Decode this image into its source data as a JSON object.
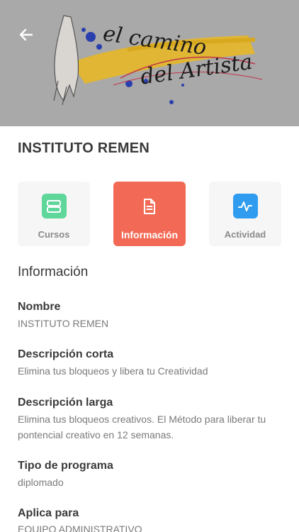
{
  "header": {
    "back_icon": "arrow-left-icon",
    "banner_line1": "el camino",
    "banner_line2": "del Artista"
  },
  "institution": {
    "title": "INSTITUTO REMEN"
  },
  "tabs": [
    {
      "label": "Cursos",
      "icon": "stacked-rows-icon",
      "icon_color": "#5fd69a"
    },
    {
      "label": "Información",
      "icon": "document-icon",
      "icon_color": "#f26a55",
      "active": true
    },
    {
      "label": "Actividad",
      "icon": "activity-pulse-icon",
      "icon_color": "#2f9cf0"
    }
  ],
  "info": {
    "section_title": "Información",
    "fields": [
      {
        "label": "Nombre",
        "value": "INSTITUTO REMEN"
      },
      {
        "label": "Descripción corta",
        "value": "Elimina tus bloqueos y libera tu Creatividad"
      },
      {
        "label": "Descripción larga",
        "value": "Elimina tus bloqueos creativos. El Método para liberar tu pontencial creativo en 12 semanas."
      },
      {
        "label": "Tipo de programa",
        "value": "diplomado"
      },
      {
        "label": "Aplica para",
        "value": "EQUIPO ADMINISTRATIVO"
      }
    ]
  },
  "colors": {
    "accent": "#f26a55",
    "courses_icon_bg": "#5fd69a",
    "activity_icon_bg": "#2f9cf0",
    "banner_bg": "#a9a9a9"
  }
}
